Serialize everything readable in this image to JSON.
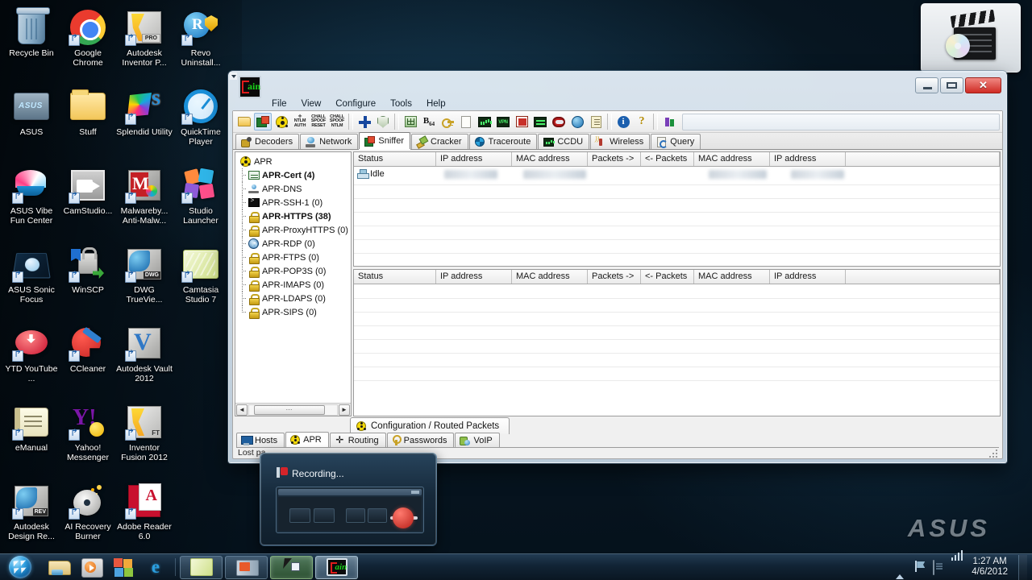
{
  "desktop": {
    "watermark": "ASUS",
    "icons": [
      {
        "label": "Recycle Bin",
        "icon": "recycle-bin-icon",
        "shortcut": false
      },
      {
        "label": "Google Chrome",
        "icon": "chrome-icon",
        "shortcut": true
      },
      {
        "label": "Autodesk Inventor P...",
        "icon": "autodesk-inventor-icon",
        "shortcut": true
      },
      {
        "label": "Revo Uninstall...",
        "icon": "revo-uninstaller-icon",
        "shortcut": true
      },
      {
        "label": "ASUS",
        "icon": "asus-folder-icon",
        "shortcut": false
      },
      {
        "label": "Stuff",
        "icon": "folder-icon",
        "shortcut": false
      },
      {
        "label": "Splendid Utility",
        "icon": "splendid-utility-icon",
        "shortcut": true
      },
      {
        "label": "QuickTime Player",
        "icon": "quicktime-icon",
        "shortcut": true
      },
      {
        "label": "ASUS Vibe Fun Center",
        "icon": "asus-vibe-icon",
        "shortcut": true
      },
      {
        "label": "CamStudio...",
        "icon": "camstudio-icon",
        "shortcut": true
      },
      {
        "label": "Malwareby... Anti-Malw...",
        "icon": "malwarebytes-icon",
        "shortcut": true
      },
      {
        "label": "Studio Launcher",
        "icon": "studio-launcher-icon",
        "shortcut": true
      },
      {
        "label": "ASUS Sonic Focus",
        "icon": "asus-sonic-focus-icon",
        "shortcut": true
      },
      {
        "label": "WinSCP",
        "icon": "winscp-icon",
        "shortcut": true
      },
      {
        "label": "DWG TrueVie...",
        "icon": "dwg-trueview-icon",
        "shortcut": true
      },
      {
        "label": "Camtasia Studio 7",
        "icon": "camtasia-icon",
        "shortcut": true
      },
      {
        "label": "YTD YouTube ...",
        "icon": "ytd-downloader-icon",
        "shortcut": true
      },
      {
        "label": "CCleaner",
        "icon": "ccleaner-icon",
        "shortcut": true
      },
      {
        "label": "Autodesk Vault 2012",
        "icon": "autodesk-vault-icon",
        "shortcut": true
      },
      {
        "label": "eManual",
        "icon": "emanual-icon",
        "shortcut": true
      },
      {
        "label": "Yahoo! Messenger",
        "icon": "yahoo-messenger-icon",
        "shortcut": true
      },
      {
        "label": "Inventor Fusion 2012",
        "icon": "inventor-fusion-icon",
        "shortcut": true
      },
      {
        "label": "Autodesk Design Re...",
        "icon": "autodesk-design-review-icon",
        "shortcut": true
      },
      {
        "label": "AI Recovery Burner",
        "icon": "ai-recovery-burner-icon",
        "shortcut": true
      },
      {
        "label": "Adobe Reader 6.0",
        "icon": "adobe-reader-icon",
        "shortcut": true
      }
    ]
  },
  "gadget": {
    "icon": "media-clapperboard-icon"
  },
  "window": {
    "app_icon": "cain-logo-icon",
    "menu": [
      "File",
      "View",
      "Configure",
      "Tools",
      "Help"
    ],
    "caption": {
      "minimize": "minimize",
      "maximize": "maximize",
      "close": "close"
    },
    "toolbar": [
      {
        "name": "open-file-button",
        "icon": "folder-icon"
      },
      {
        "name": "start-stop-sniffer-button",
        "icon": "nic-icon"
      },
      {
        "name": "start-stop-apr-button",
        "icon": "radiation-icon"
      },
      {
        "name": "ntlm-auth-button",
        "icon": "ntlm-auth-text-icon",
        "text": "NTLM AUTH"
      },
      {
        "name": "chall-spoof-reset-button",
        "icon": "chall-spoof-reset-text-icon",
        "text": "CHALL SPOOF RESET"
      },
      {
        "name": "chall-spoof-ntlm-button",
        "icon": "chall-spoof-ntlm-text-icon",
        "text": "CHALL SPOOF NTLM"
      },
      {
        "name": "add-to-list-button",
        "icon": "plus-icon"
      },
      {
        "name": "remove-button",
        "icon": "shield-icon"
      },
      {
        "name": "table-button",
        "icon": "grid-icon"
      },
      {
        "name": "base64-decoder-button",
        "icon": "base64-icon",
        "text": "B64"
      },
      {
        "name": "cisco-pix-button",
        "icon": "key-icon"
      },
      {
        "name": "access-db-button",
        "icon": "document-icon"
      },
      {
        "name": "cisco-type7-button",
        "icon": "bars-icon"
      },
      {
        "name": "vnc-password-button",
        "icon": "vpn-icon"
      },
      {
        "name": "rdp-sniffer-button",
        "icon": "rdp-icon"
      },
      {
        "name": "hash-calculator-button",
        "icon": "terminal-icon"
      },
      {
        "name": "rsa-token-button",
        "icon": "oval-icon"
      },
      {
        "name": "wireless-scanner-button",
        "icon": "globe-icon"
      },
      {
        "name": "note-button",
        "icon": "note-icon"
      },
      {
        "name": "about-button",
        "icon": "info-icon"
      },
      {
        "name": "help-button",
        "icon": "help-icon"
      },
      {
        "name": "exit-button",
        "icon": "tower-icon"
      }
    ],
    "tabs": [
      {
        "label": "Decoders",
        "icon": "decoders-icon",
        "selected": false
      },
      {
        "label": "Network",
        "icon": "network-icon",
        "selected": false
      },
      {
        "label": "Sniffer",
        "icon": "sniffer-icon",
        "selected": true
      },
      {
        "label": "Cracker",
        "icon": "cracker-icon",
        "selected": false
      },
      {
        "label": "Traceroute",
        "icon": "traceroute-icon",
        "selected": false
      },
      {
        "label": "CCDU",
        "icon": "ccdu-icon",
        "selected": false
      },
      {
        "label": "Wireless",
        "icon": "wireless-icon",
        "selected": false
      },
      {
        "label": "Query",
        "icon": "query-icon",
        "selected": false
      }
    ],
    "tree": {
      "root": {
        "label": "APR",
        "icon": "radiation-icon"
      },
      "items": [
        {
          "label": "APR-Cert (4)",
          "icon": "cert-icon",
          "bold": true
        },
        {
          "label": "APR-DNS",
          "icon": "dns-icon",
          "bold": false
        },
        {
          "label": "APR-SSH-1 (0)",
          "icon": "ssh-icon",
          "bold": false
        },
        {
          "label": "APR-HTTPS (38)",
          "icon": "lock-icon",
          "bold": true
        },
        {
          "label": "APR-ProxyHTTPS (0)",
          "icon": "lock-icon",
          "bold": false
        },
        {
          "label": "APR-RDP (0)",
          "icon": "rdp-icon",
          "bold": false
        },
        {
          "label": "APR-FTPS (0)",
          "icon": "lock-icon",
          "bold": false
        },
        {
          "label": "APR-POP3S (0)",
          "icon": "lock-icon",
          "bold": false
        },
        {
          "label": "APR-IMAPS (0)",
          "icon": "lock-icon",
          "bold": false
        },
        {
          "label": "APR-LDAPS (0)",
          "icon": "lock-icon",
          "bold": false
        },
        {
          "label": "APR-SIPS (0)",
          "icon": "lock-icon",
          "bold": false
        }
      ]
    },
    "grid_columns": [
      "Status",
      "IP address",
      "MAC address",
      "Packets ->",
      "<- Packets",
      "MAC address",
      "IP address"
    ],
    "grid_top_rows": [
      {
        "status": "Idle",
        "icon": "host-icon"
      }
    ],
    "grid_bottom_rows": [],
    "dock_tab": {
      "label": "Configuration / Routed Packets",
      "icon": "radiation-icon"
    },
    "bottom_tabs": [
      {
        "label": "Hosts",
        "icon": "hosts-icon",
        "selected": false
      },
      {
        "label": "APR",
        "icon": "radiation-icon",
        "selected": true
      },
      {
        "label": "Routing",
        "icon": "routing-icon",
        "selected": false
      },
      {
        "label": "Passwords",
        "icon": "passwords-key-icon",
        "selected": false
      },
      {
        "label": "VoIP",
        "icon": "voip-icon",
        "selected": false
      }
    ],
    "statusbar": "Lost pa"
  },
  "recording_popup": {
    "title": "Recording...",
    "icon": "recording-pin-icon"
  },
  "taskbar": {
    "start": "start-orb",
    "quick_launch": [
      {
        "name": "quicklaunch-explorer",
        "icon": "explorer-icon"
      },
      {
        "name": "quicklaunch-media-player",
        "icon": "windows-media-player-icon"
      },
      {
        "name": "quicklaunch-flip3d",
        "icon": "flip-3d-icon"
      },
      {
        "name": "quicklaunch-internet-explorer",
        "icon": "internet-explorer-icon"
      }
    ],
    "buttons": [
      {
        "name": "taskbar-camtasia",
        "icon": "camtasia-icon",
        "active": false
      },
      {
        "name": "taskbar-camstudio",
        "icon": "camstudio-icon",
        "active": false
      },
      {
        "name": "taskbar-recorder",
        "icon": "cursor-icon",
        "active": true
      },
      {
        "name": "taskbar-cain",
        "icon": "cain-logo-icon",
        "active": true
      }
    ],
    "tray": [
      {
        "name": "tray-show-hidden-icons",
        "icon": "chevron-up-icon"
      },
      {
        "name": "tray-network",
        "icon": "network-flag-icon"
      },
      {
        "name": "tray-action-center",
        "icon": "action-center-icon"
      },
      {
        "name": "tray-signal",
        "icon": "signal-bars-icon"
      }
    ],
    "clock": {
      "time": "1:27 AM",
      "date": "4/6/2012"
    }
  }
}
